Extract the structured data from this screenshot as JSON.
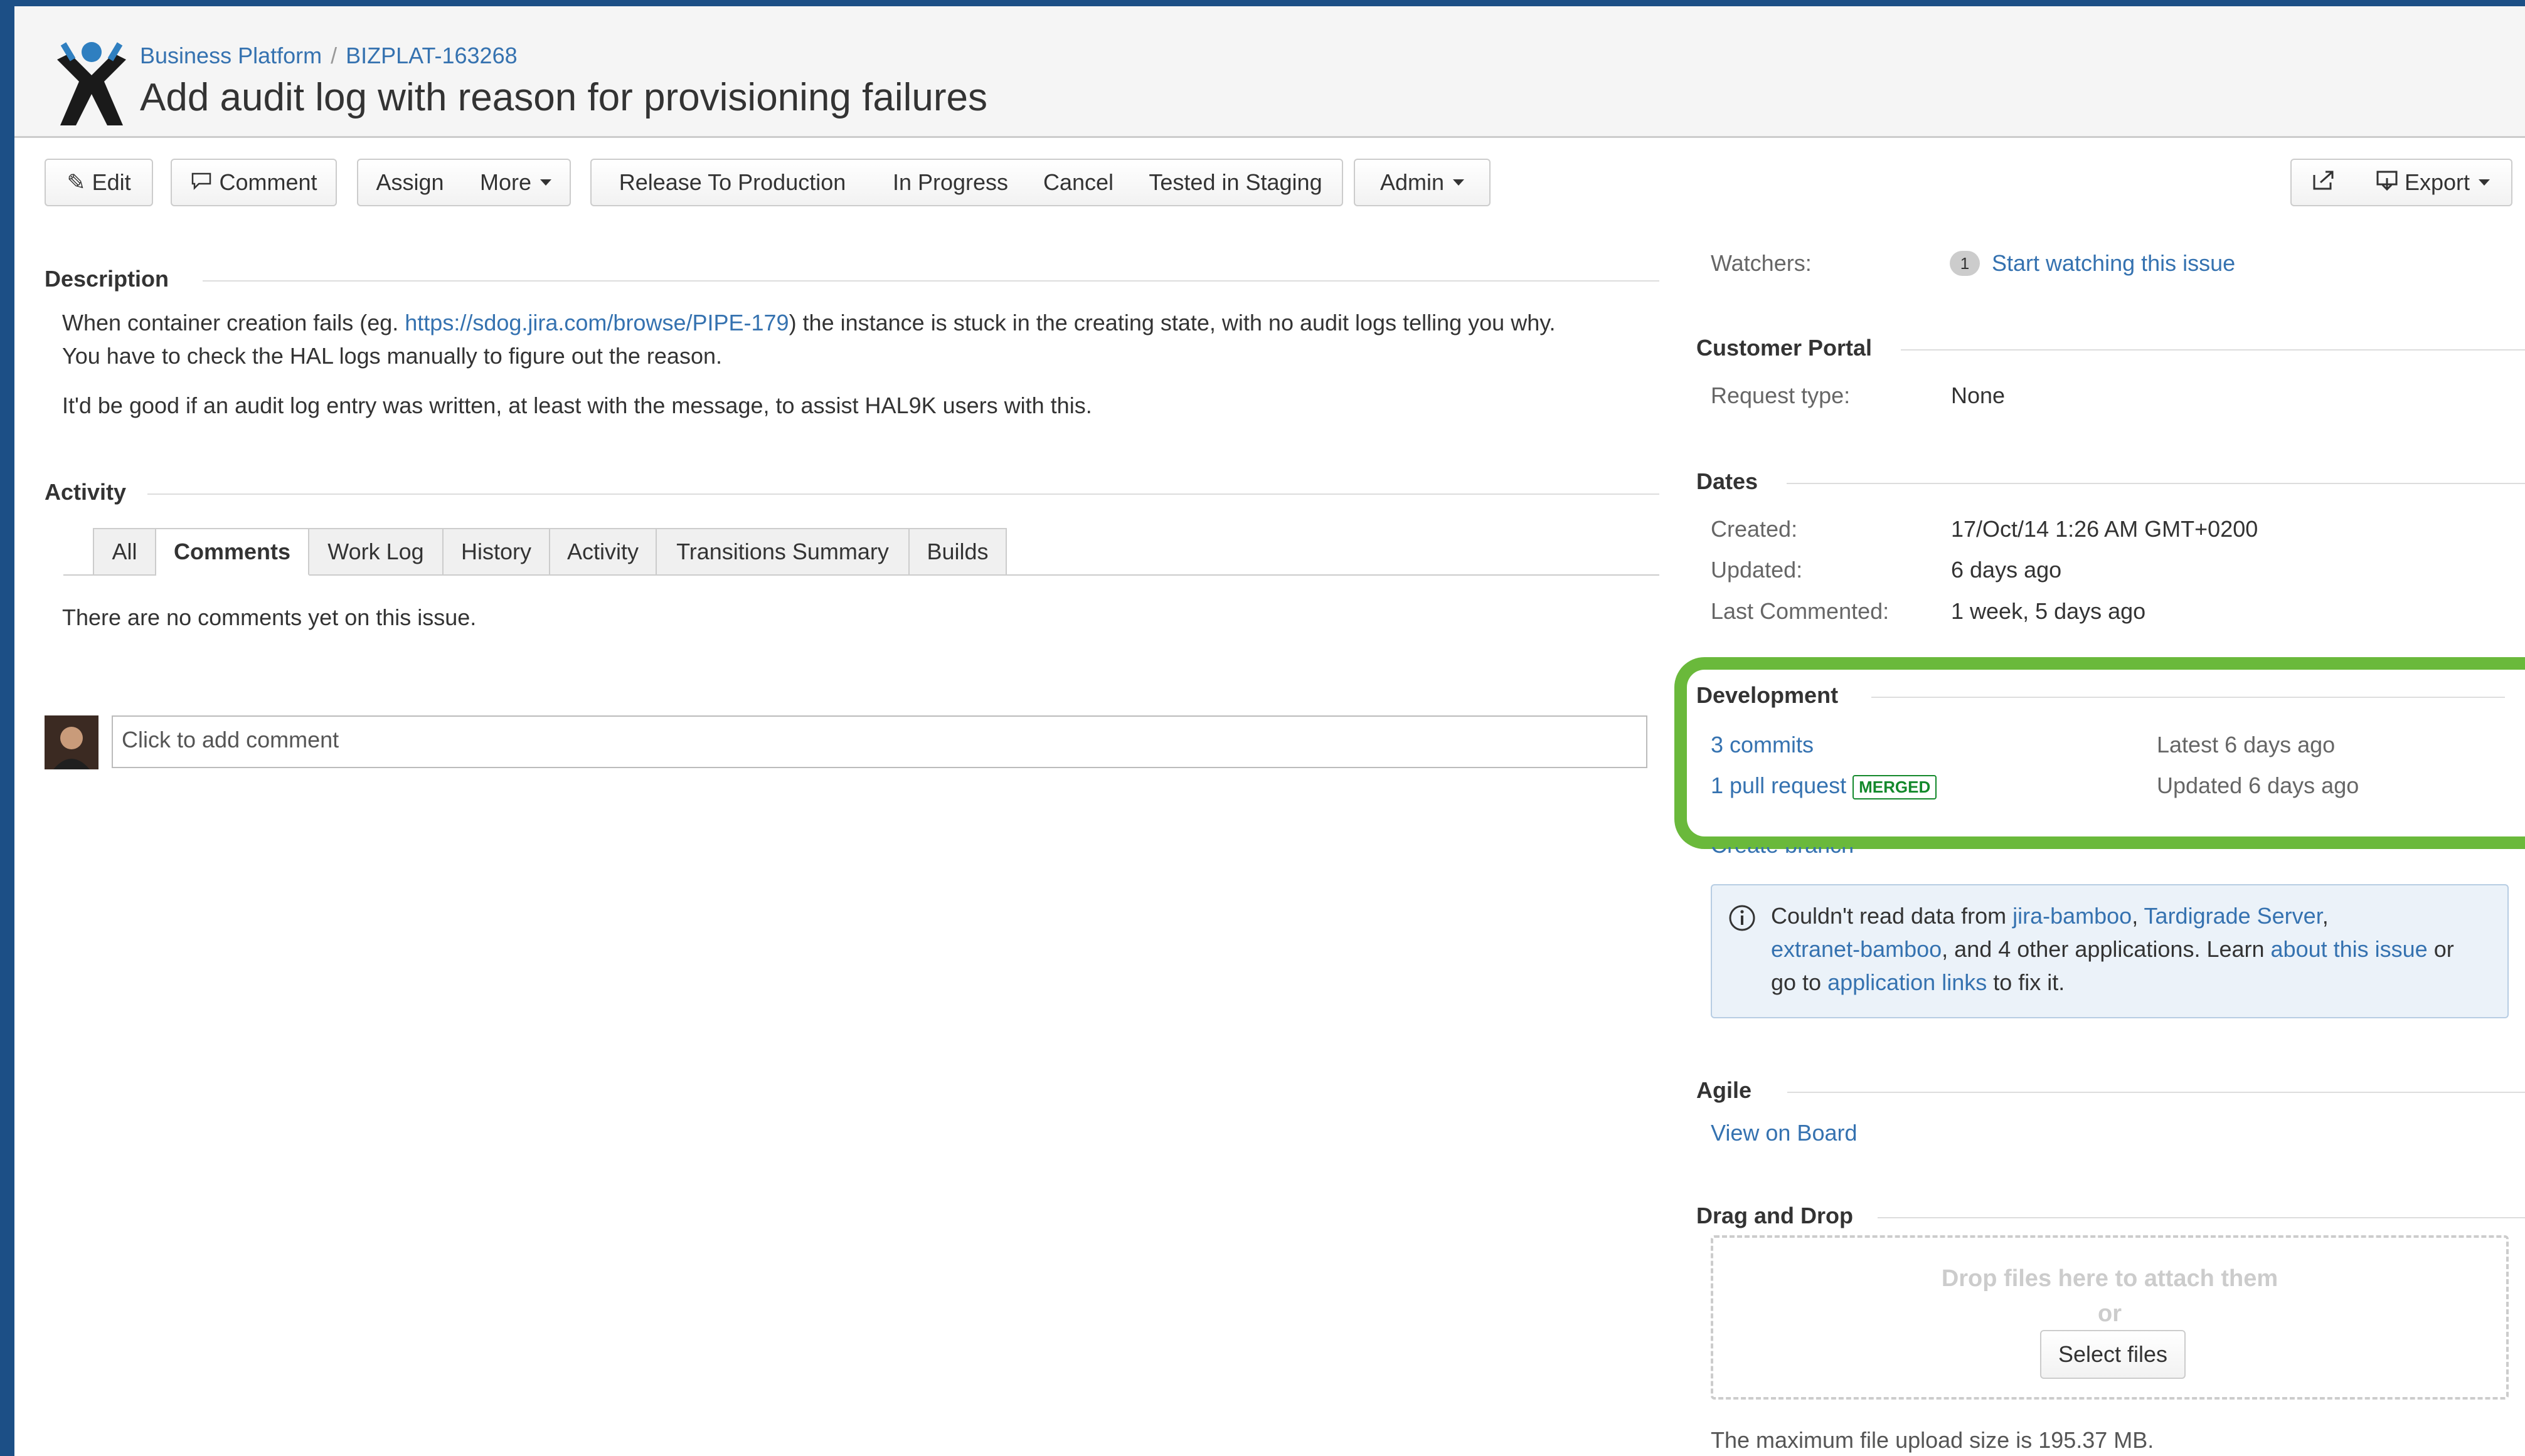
{
  "breadcrumb": {
    "project": "Business Platform",
    "separator": "/",
    "issue_key": "BIZPLAT-163268"
  },
  "issue": {
    "title": "Add audit log with reason for provisioning failures"
  },
  "toolbar": {
    "edit": "Edit",
    "comment": "Comment",
    "assign": "Assign",
    "more": "More",
    "release": "Release To Production",
    "in_progress": "In Progress",
    "cancel": "Cancel",
    "tested": "Tested in Staging",
    "admin": "Admin",
    "export": "Export",
    "icons": {
      "edit": "pencil-icon",
      "comment": "speech-bubble-icon",
      "share": "share-icon",
      "export": "export-icon"
    }
  },
  "description": {
    "heading": "Description",
    "p1_before": "When container creation fails (eg. ",
    "p1_link": "https://sdog.jira.com/browse/PIPE-179",
    "p1_after": ") the instance is stuck in the creating state, with no audit logs telling you why.",
    "p1_line2": "You have to check the HAL logs manually to figure out the reason.",
    "p2": "It'd be good if an audit log entry was written, at least with the message, to assist HAL9K users with this."
  },
  "activity": {
    "heading": "Activity",
    "tabs": [
      "All",
      "Comments",
      "Work Log",
      "History",
      "Activity",
      "Transitions Summary",
      "Builds"
    ],
    "active_tab": "Comments",
    "empty_message": "There are no comments yet on this issue.",
    "comment_placeholder": "Click to add comment"
  },
  "sidebar": {
    "watchers": {
      "label": "Watchers:",
      "count": "1",
      "action": "Start watching this issue"
    },
    "customer_portal": {
      "heading": "Customer Portal",
      "request_type_label": "Request type:",
      "request_type_value": "None"
    },
    "dates": {
      "heading": "Dates",
      "created_label": "Created:",
      "created_value": "17/Oct/14 1:26 AM GMT+0200",
      "updated_label": "Updated:",
      "updated_value": "6 days ago",
      "last_commented_label": "Last Commented:",
      "last_commented_value": "1 week, 5 days ago"
    },
    "development": {
      "heading": "Development",
      "commits": "3 commits",
      "commits_meta": "Latest 6 days ago",
      "pull_request": "1 pull request",
      "pr_status": "MERGED",
      "pr_meta": "Updated 6 days ago",
      "create_branch": "Create branch",
      "highlight_color": "#6ab93b"
    },
    "info": {
      "icon": "info-icon",
      "t1": "Couldn't read data from ",
      "l1": "jira-bamboo",
      "t2": ", ",
      "l2": "Tardigrade Server",
      "t3": ",",
      "l3": "extranet-bamboo",
      "t4": ", and 4 other applications. Learn ",
      "l4": "about this issue",
      "t5": " or",
      "t6": "go to ",
      "l5": "application links",
      "t7": " to fix it."
    },
    "agile": {
      "heading": "Agile",
      "link": "View on Board"
    },
    "drag_drop": {
      "heading": "Drag and Drop",
      "drop_text": "Drop files here to attach them",
      "or": "or",
      "button": "Select files",
      "max_size": "The maximum file upload size is 195.37 MB."
    }
  },
  "colors": {
    "link": "#3572b0",
    "frame": "#1c4f86",
    "merged": "#14892c"
  }
}
